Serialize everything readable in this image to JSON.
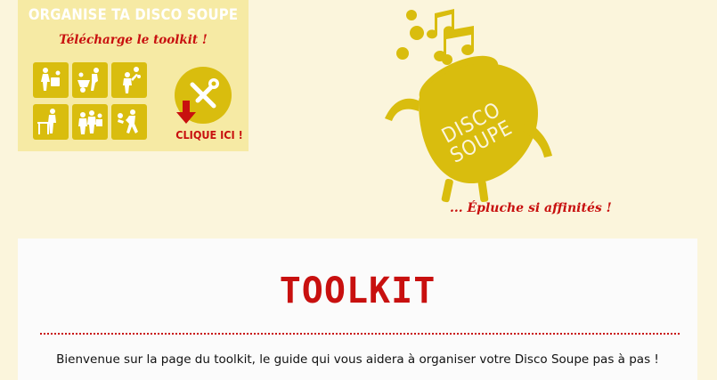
{
  "promo": {
    "title": "ORGANISE TA DISCO SOUPE",
    "subtitle": "Télécharge le toolkit !",
    "cta": "CLIQUE ICI !",
    "tiles": [
      "people-carrying-icon",
      "wheelbarrow-icon",
      "juggling-icon",
      "table-cook-icon",
      "crowd-icon",
      "dancing-icon"
    ],
    "tool_icon": "tools-icon",
    "arrow_icon": "download-arrow-icon"
  },
  "logo": {
    "text_line1": "DISCO",
    "text_line2": "SOUPE",
    "tagline": "... Épluche si affinités !"
  },
  "content": {
    "title": "TOOLKIT",
    "intro": "Bienvenue sur la page du toolkit, le guide qui vous aidera à organiser votre Disco Soupe pas à pas !"
  },
  "colors": {
    "background": "#fbf5dc",
    "brand_yellow": "#d9bd0e",
    "brand_red": "#c8100f",
    "banner_bg": "#f6eaa4",
    "card_bg": "#fbfbfb"
  }
}
